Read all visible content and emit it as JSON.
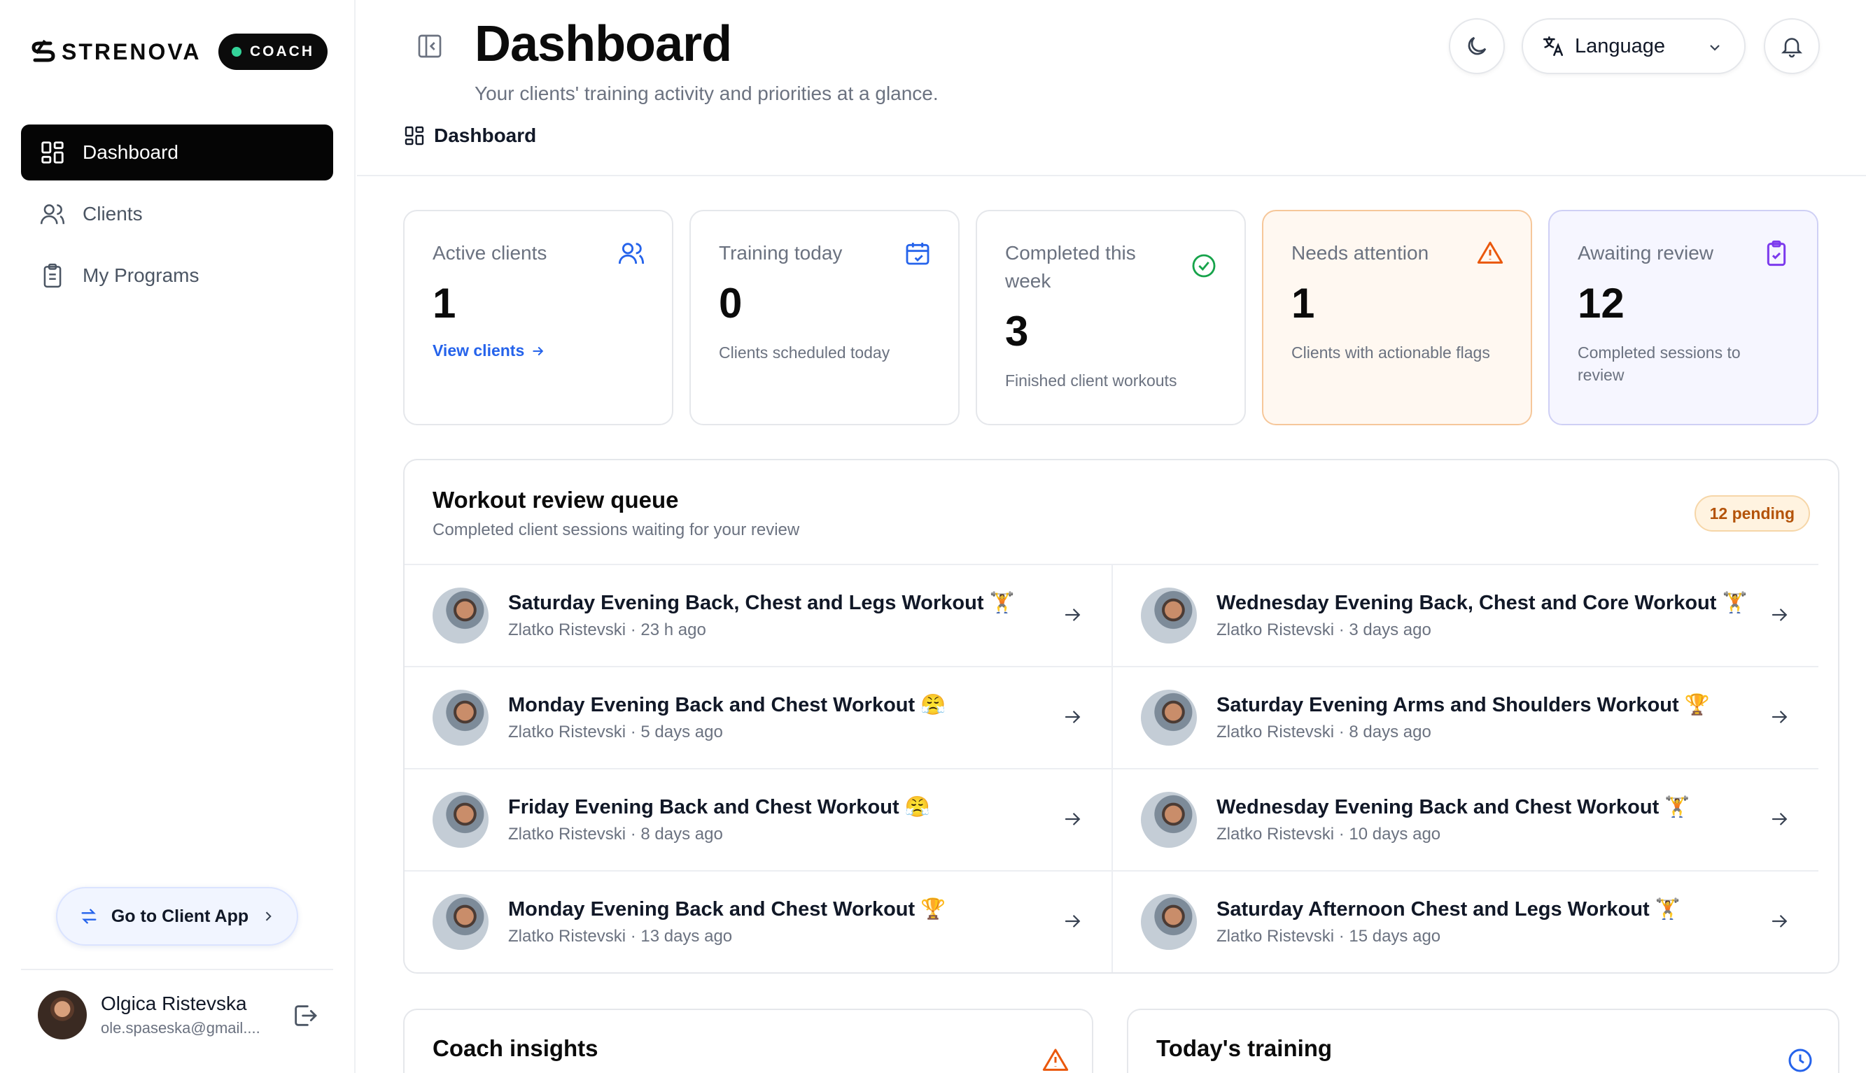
{
  "brand": {
    "name": "STRENOVA",
    "badge": "COACH"
  },
  "sidebar": {
    "items": [
      {
        "label": "Dashboard",
        "icon": "grid-icon",
        "active": true
      },
      {
        "label": "Clients",
        "icon": "users-icon",
        "active": false
      },
      {
        "label": "My Programs",
        "icon": "clipboard-icon",
        "active": false
      }
    ],
    "client_app_label": "Go to Client App",
    "user": {
      "name": "Olgica Ristevska",
      "email": "ole.spaseska@gmail...."
    }
  },
  "header": {
    "title": "Dashboard",
    "subtitle": "Your clients' training activity and priorities at a glance.",
    "breadcrumb": "Dashboard",
    "language_label": "Language"
  },
  "stats": [
    {
      "label": "Active clients",
      "value": "1",
      "link": "View clients",
      "note": "",
      "icon": "users-icon",
      "icon_color": "#2563eb"
    },
    {
      "label": "Training today",
      "value": "0",
      "note": "Clients scheduled today",
      "icon": "calendar-check-icon",
      "icon_color": "#2563eb"
    },
    {
      "label": "Completed this week",
      "value": "3",
      "note": "Finished client workouts",
      "icon": "check-circle-icon",
      "icon_color": "#16a34a"
    },
    {
      "label": "Needs attention",
      "value": "1",
      "note": "Clients with actionable flags",
      "icon": "warning-icon",
      "icon_color": "#ea580c"
    },
    {
      "label": "Awaiting review",
      "value": "12",
      "note": "Completed sessions to review",
      "icon": "clipboard-check-icon",
      "icon_color": "#7c3aed"
    }
  ],
  "queue": {
    "title": "Workout review queue",
    "subtitle": "Completed client sessions waiting for your review",
    "pending": "12 pending",
    "items": [
      {
        "title": "Saturday Evening Back, Chest and Legs Workout 🏋️",
        "client": "Zlatko Ristevski",
        "time": "23 h ago"
      },
      {
        "title": "Wednesday Evening Back, Chest and Core Workout 🏋️",
        "client": "Zlatko Ristevski",
        "time": "3 days ago"
      },
      {
        "title": "Monday Evening Back and Chest Workout 😤",
        "client": "Zlatko Ristevski",
        "time": "5 days ago"
      },
      {
        "title": "Saturday Evening Arms and Shoulders Workout 🏆",
        "client": "Zlatko Ristevski",
        "time": "8 days ago"
      },
      {
        "title": "Friday Evening Back and Chest Workout 😤",
        "client": "Zlatko Ristevski",
        "time": "8 days ago"
      },
      {
        "title": "Wednesday Evening Back and Chest Workout 🏋️",
        "client": "Zlatko Ristevski",
        "time": "10 days ago"
      },
      {
        "title": "Monday Evening Back and Chest Workout 🏆",
        "client": "Zlatko Ristevski",
        "time": "13 days ago"
      },
      {
        "title": "Saturday Afternoon Chest and Legs Workout 🏋️",
        "client": "Zlatko Ristevski",
        "time": "15 days ago"
      }
    ]
  },
  "insights": {
    "title": "Coach insights"
  },
  "today": {
    "title": "Today's training"
  }
}
